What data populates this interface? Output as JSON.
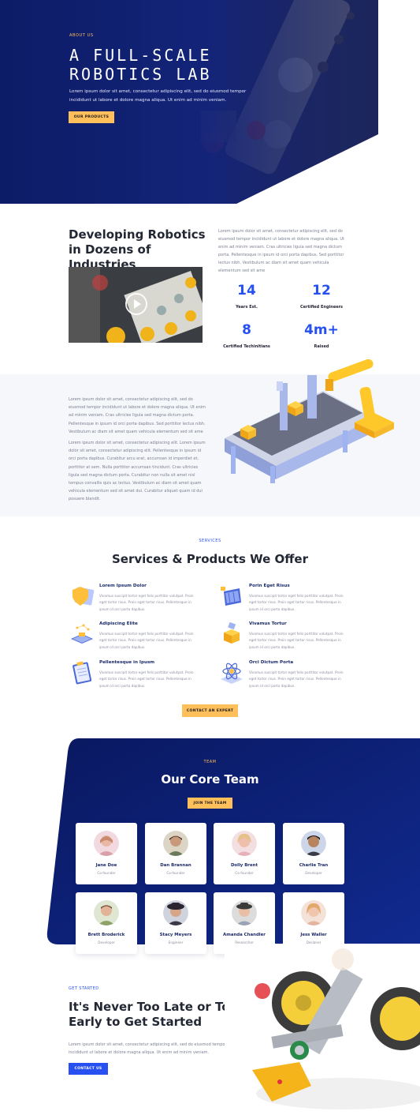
{
  "hero": {
    "eyebrow": "ABOUT US",
    "title_line1": "A FULL-SCALE",
    "title_line2": "ROBOTICS LAB",
    "subtitle": "Lorem ipsum dolor sit amet, consectetur adipiscing elit, sed do eiusmod tempor incididunt ut labore et dolore magna aliqua. Ut enim ad minim veniam.",
    "button": "OUR PRODUCTS"
  },
  "about": {
    "title": "Developing Robotics in Dozens of Industries",
    "text": "Lorem ipsum dolor sit amet, consectetur adipiscing elit, sed do eiusmod tempor incididunt ut labore et dolore magna aliqua. Ut enim ad minim veniam. Cras ultricies ligula sed magna dictum porta. Pellentesque in ipsum id orci porta dapibus. Sed porttitor lectus nibh. Vestibulum ac diam sit amet quam vehicula elementum sed sit ame",
    "stats": [
      {
        "value": "14",
        "label": "Years Est."
      },
      {
        "value": "12",
        "label": "Certified Engineers"
      },
      {
        "value": "8",
        "label": "Certified Techinitians"
      },
      {
        "value": "4m+",
        "label": "Raised"
      }
    ]
  },
  "manufacturing": {
    "para1": "Lorem ipsum dolor sit amet, consectetur adipiscing elit, sed do eiusmod tempor incididunt ut labore et dolore magna aliqua. Ut enim ad minim veniam. Cras ultricies ligula sed magna dictum porta. Pellentesque in ipsum id orci porta dapibus. Sed porttitor lectus nibh. Vestibulum ac diam sit amet quam vehicula elementum sed sit ame",
    "para2": "Lorem ipsum dolor sit amet, consectetur adipiscing elit. Lorem ipsum dolor sit amet, consectetur adipiscing elit. Pellentesque in ipsum id orci porta dapibus. Curabitur arcu erat, accumsan id imperdiet et, porttitor at sem. Nulla porttitor accumsan tincidunt. Cras ultricies ligula sed magna dictum porta. Curabitur non nulla sit amet nisl tempus convallis quis ac lectus. Vestibulum ac diam sit amet quam vehicula elementum sed sit amet dui. Curabitur aliquet quam id dui posuere blandit."
  },
  "services": {
    "eyebrow": "SERVICES",
    "title": "Services & Products We Offer",
    "items": [
      {
        "title": "Lorem Ipsum Dolor",
        "desc": "Vivamus suscipit tortor eget felis porttitor volutpat. Proin eget tortor risus. Proin eget tortor risus. Pellentesque in ipsum id orci porta dapibus.",
        "icon": "shield-icon"
      },
      {
        "title": "Porin Eget Risus",
        "desc": "Vivamus suscipit tortor eget felis porttitor volutpat. Proin eget tortor risus. Proin eget tortor risus. Pellentesque in ipsum id orci porta dapibus.",
        "icon": "solar-panel-icon"
      },
      {
        "title": "Adipiscing Elite",
        "desc": "Vivamus suscipit tortor eget felis porttitor volutpat. Proin eget tortor risus. Proin eget tortor risus. Pellentesque in ipsum id orci porta dapibus.",
        "icon": "circuit-board-icon"
      },
      {
        "title": "Vivamus Tortur",
        "desc": "Vivamus suscipit tortor eget felis porttitor volutpat. Proin eget tortor risus. Proin eget tortor risus. Pellentesque in ipsum id orci porta dapibus.",
        "icon": "package-icon"
      },
      {
        "title": "Pellentesque in Ipusm",
        "desc": "Vivamus suscipit tortor eget felis porttitor volutpat. Proin eget tortor risus. Proin eget tortor risus. Pellentesque in ipsum id orci porta dapibus.",
        "icon": "clipboard-icon"
      },
      {
        "title": "Orci Dictum Porta",
        "desc": "Vivamus suscipit tortor eget felis porttitor volutpat. Proin eget tortor risus. Proin eget tortor risus. Pellentesque in ipsum id orci porta dapibus.",
        "icon": "atom-icon"
      }
    ],
    "button": "CONTACT AN EXPERT"
  },
  "team": {
    "eyebrow": "TEAM",
    "title": "Our Core Team",
    "button": "JOIN THE TEAM",
    "members": [
      {
        "name": "Jane Doe",
        "role": "Co-founder"
      },
      {
        "name": "Dan Brannan",
        "role": "Co-founder"
      },
      {
        "name": "Dolly Brent",
        "role": "Co-founder"
      },
      {
        "name": "Charlie Tran",
        "role": "Developer"
      },
      {
        "name": "Brett Broderick",
        "role": "Developer"
      },
      {
        "name": "Stacy Meyers",
        "role": "Engineer"
      },
      {
        "name": "Amanda Chandler",
        "role": "Researcher"
      },
      {
        "name": "Jess Waller",
        "role": "Designer"
      }
    ]
  },
  "cta": {
    "eyebrow": "GET STARTED",
    "title": "It's Never Too Late or Too Early to Get Started",
    "text": "Lorem ipsum dolor sit amet, consectetur adipiscing elit, sed do eiusmod tempor incididunt ut labore et dolore magna aliqua. Ut enim ad minim veniam.",
    "button": "CONTACT US"
  },
  "colors": {
    "navy": "#0b1b63",
    "accent_yellow": "#ffbf5a",
    "accent_blue": "#2650f0"
  }
}
